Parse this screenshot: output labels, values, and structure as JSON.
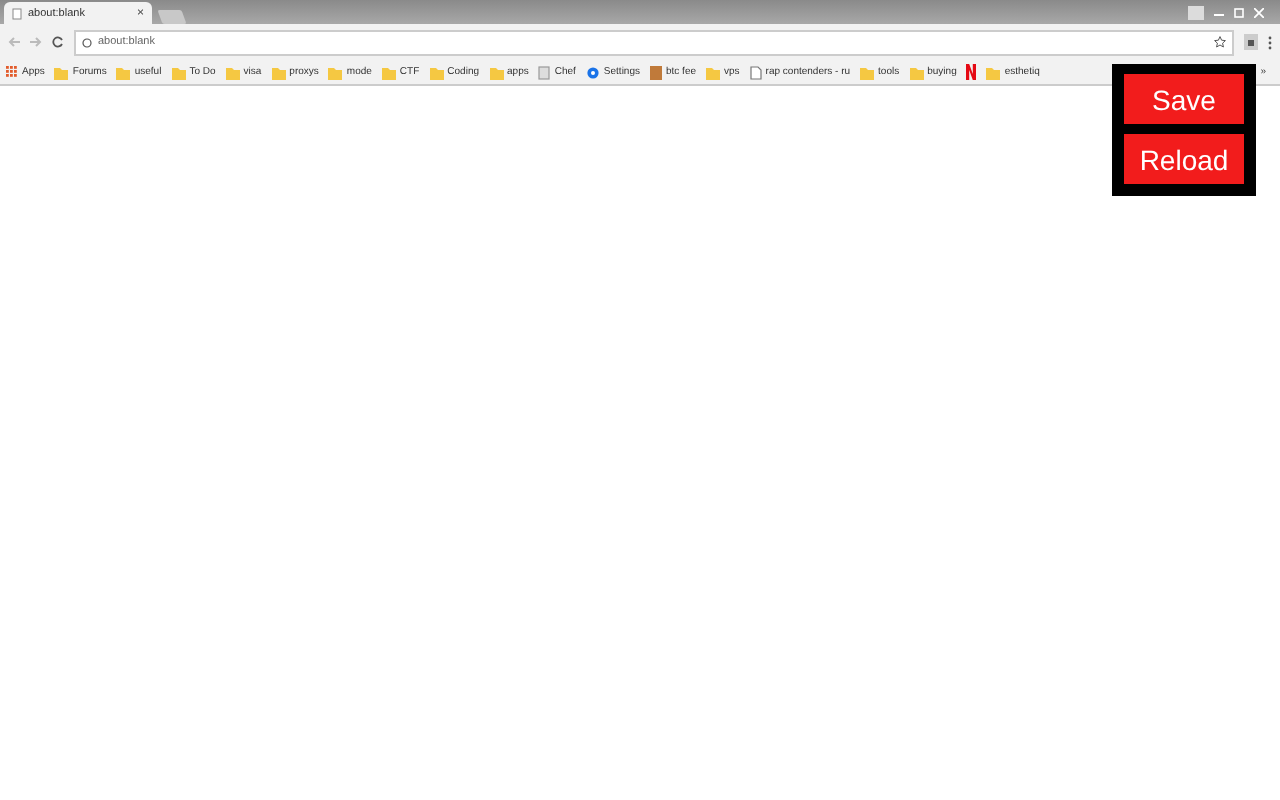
{
  "tab": {
    "title": "about:blank",
    "close": "×"
  },
  "address_bar": {
    "value": "about:blank"
  },
  "bookmarks": [
    {
      "kind": "apps",
      "label": "Apps"
    },
    {
      "kind": "folder",
      "label": "Forums"
    },
    {
      "kind": "folder",
      "label": "useful"
    },
    {
      "kind": "folder",
      "label": "To Do"
    },
    {
      "kind": "folder",
      "label": "visa"
    },
    {
      "kind": "folder",
      "label": "proxys"
    },
    {
      "kind": "folder",
      "label": "mode"
    },
    {
      "kind": "folder",
      "label": "CTF"
    },
    {
      "kind": "folder",
      "label": "Coding"
    },
    {
      "kind": "folder",
      "label": "apps"
    },
    {
      "kind": "page",
      "label": "Chef"
    },
    {
      "kind": "gear",
      "label": "Settings"
    },
    {
      "kind": "tile",
      "label": "btc fee"
    },
    {
      "kind": "folder",
      "label": "vps"
    },
    {
      "kind": "doc",
      "label": "rap contenders - ru"
    },
    {
      "kind": "folder",
      "label": "tools"
    },
    {
      "kind": "folder",
      "label": "buying"
    },
    {
      "kind": "redtile"
    },
    {
      "kind": "folder",
      "label": "esthetiq"
    }
  ],
  "more_bookmarks": "»",
  "popup": {
    "buttons": [
      "Save",
      "Reload"
    ]
  }
}
